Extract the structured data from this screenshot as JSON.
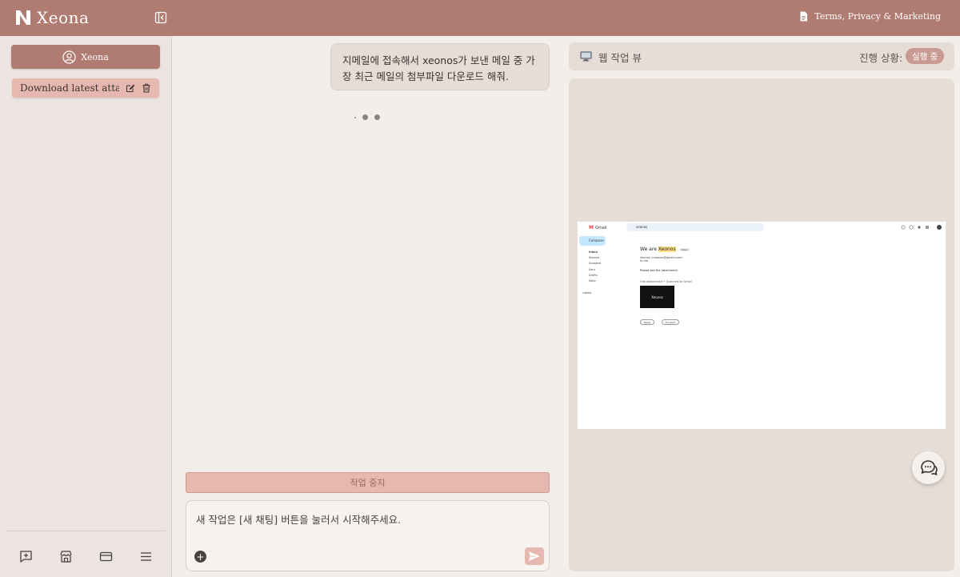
{
  "header": {
    "app_name": "Xeona",
    "terms_label": "Terms, Privacy & Marketing"
  },
  "sidebar": {
    "account_label": "Xeona",
    "chat_items": [
      {
        "label": "Download latest attac…"
      }
    ],
    "bottom_icons": [
      "new-chat-icon",
      "store-icon",
      "card-icon",
      "menu-icon"
    ]
  },
  "chat": {
    "user_message": "지메일에 접속해서 xeonos가 보낸 메일 중 가장 최근 메일의 첨부파일 다운로드 해줘.",
    "stop_label": "작업 중지",
    "input_placeholder": "새 작업은 [새 채팅] 버튼을 눌러서 시작해주세요."
  },
  "web_view": {
    "title": "웹 작업 뷰",
    "progress_label": "진행 상황:",
    "status": "실행 중",
    "gmail": {
      "app_label": "Gmail",
      "search_query": "xeonos",
      "compose_label": "Compose",
      "nav": [
        "Inbox",
        "Starred",
        "Snoozed",
        "Sent",
        "Drafts",
        "More"
      ],
      "labels_heading": "Labels",
      "subject_prefix": "We are ",
      "subject_highlight": "Xeonos",
      "inbox_badge": "Inbox",
      "sender": "Xeonos <xeonos@gmail.com>",
      "recipient": "to me",
      "body": "Please see the attachment",
      "attachment_label": "One attachment • Scanned by Gmail",
      "attachment_name": "Xeonos",
      "reply_label": "Reply",
      "forward_label": "Forward"
    }
  },
  "colors": {
    "brand": "#b07b70",
    "accent_light": "#e6b8b0",
    "panel": "#e6ddd7",
    "background": "#f2eeea"
  }
}
